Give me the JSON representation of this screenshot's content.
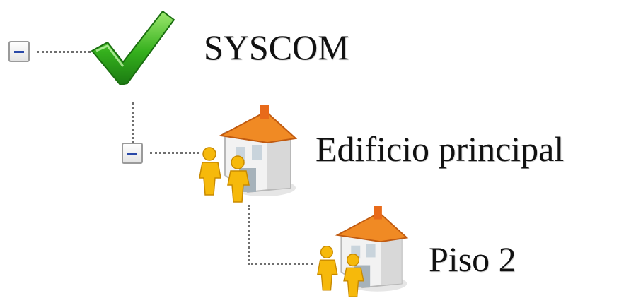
{
  "tree": {
    "nodes": [
      {
        "label": "SYSCOM",
        "icon": "checkmark-icon",
        "expanded": true,
        "level": 0
      },
      {
        "label": "Edificio principal",
        "icon": "building-icon",
        "expanded": true,
        "level": 1
      },
      {
        "label": "Piso 2",
        "icon": "building-icon",
        "expanded": false,
        "level": 2
      }
    ]
  },
  "colors": {
    "check_green": "#35b01d",
    "building_roof": "#f08a24",
    "people_yellow": "#f6b90b",
    "toggle_minus": "#2a49a8",
    "dotted_line": "#6f6f6f"
  }
}
